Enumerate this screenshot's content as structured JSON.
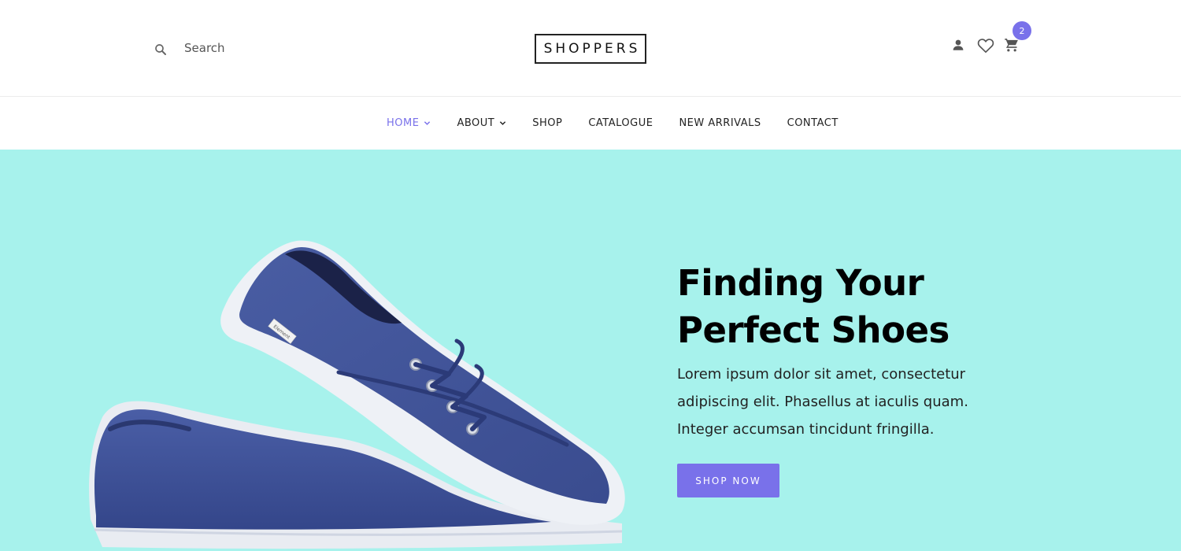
{
  "header": {
    "search": {
      "placeholder": "Search"
    },
    "logo": "SHOPPERS",
    "cart_count": "2"
  },
  "nav": {
    "items": [
      {
        "label": "HOME",
        "active": true,
        "dropdown": true
      },
      {
        "label": "ABOUT",
        "active": false,
        "dropdown": true
      },
      {
        "label": "SHOP",
        "active": false,
        "dropdown": false
      },
      {
        "label": "CATALOGUE",
        "active": false,
        "dropdown": false
      },
      {
        "label": "NEW ARRIVALS",
        "active": false,
        "dropdown": false
      },
      {
        "label": "CONTACT",
        "active": false,
        "dropdown": false
      }
    ]
  },
  "hero": {
    "title_line1": "Finding Your",
    "title_line2": "Perfect Shoes",
    "description": "Lorem ipsum dolor sit amet, consectetur adipiscing elit. Phasellus at iaculis quam. Integer accumsan tincidunt fringilla.",
    "button_label": "SHOP NOW",
    "shoe_label": "Element"
  },
  "colors": {
    "accent": "#7971ea",
    "hero_bg": "#a7f2ec",
    "shoe_blue": "#3c4f93"
  },
  "icons": {
    "search": "search-icon",
    "user": "user-icon",
    "wishlist": "heart-icon",
    "cart": "cart-icon",
    "dropdown": "chevron-down-icon"
  }
}
